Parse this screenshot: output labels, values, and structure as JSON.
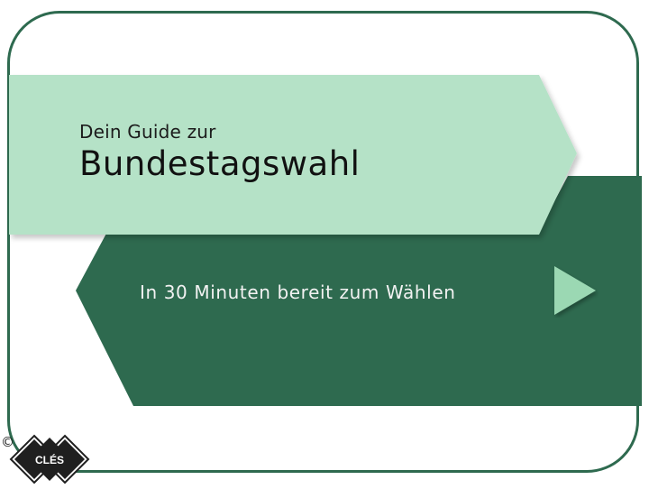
{
  "slide": {
    "subtitle": "Dein Guide zur",
    "title": "Bundestagswahl",
    "tagline": "In 30 Minuten bereit zum Wählen",
    "play_icon": "play-triangle-icon"
  },
  "footer": {
    "copyright_symbol": "©",
    "logo_text": "CLÉS"
  },
  "colors": {
    "frame_border": "#2e6a4f",
    "light_banner": "#b5e2c7",
    "dark_banner": "#2e6a4f",
    "play_icon": "#9bd8b3",
    "logo": "#1f1f1f"
  }
}
